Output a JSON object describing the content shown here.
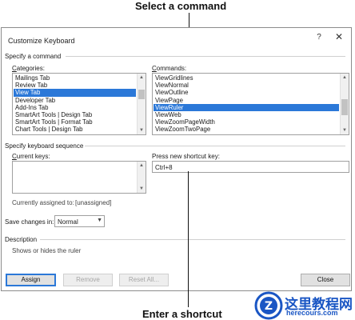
{
  "callouts": {
    "top": "Select a command",
    "bottom": "Enter a shortcut"
  },
  "dialog": {
    "title": "Customize Keyboard",
    "help": "?",
    "close": "✕"
  },
  "specify_command": {
    "heading": "Specify a command",
    "categories_label": "Categories:",
    "commands_label": "Commands:",
    "categories": [
      "Mailings Tab",
      "Review Tab",
      "View Tab",
      "Developer Tab",
      "Add-Ins Tab",
      "SmartArt Tools | Design Tab",
      "SmartArt Tools | Format Tab",
      "Chart Tools | Design Tab"
    ],
    "categories_selected": "View Tab",
    "commands": [
      "ViewGridlines",
      "ViewNormal",
      "ViewOutline",
      "ViewPage",
      "ViewRuler",
      "ViewWeb",
      "ViewZoomPageWidth",
      "ViewZoomTwoPage"
    ],
    "commands_selected": "ViewRuler"
  },
  "keyboard_sequence": {
    "heading": "Specify keyboard sequence",
    "current_keys_label": "Current keys:",
    "new_shortcut_label": "Press new shortcut key:",
    "new_shortcut_value": "Ctrl+8",
    "assigned_label": "Currently assigned to:",
    "assigned_value": "[unassigned]"
  },
  "save_changes": {
    "label": "Save changes in:",
    "value": "Normal"
  },
  "description": {
    "heading": "Description",
    "text": "Shows or hides the ruler"
  },
  "buttons": {
    "assign": "Assign",
    "remove": "Remove",
    "reset_all": "Reset All...",
    "close": "Close"
  },
  "watermark": {
    "cn": "这里教程网",
    "en": "herecours.com",
    "logo_letter": "Z"
  },
  "colors": {
    "selection": "#2b78d8",
    "watermark": "#1a56c4"
  }
}
